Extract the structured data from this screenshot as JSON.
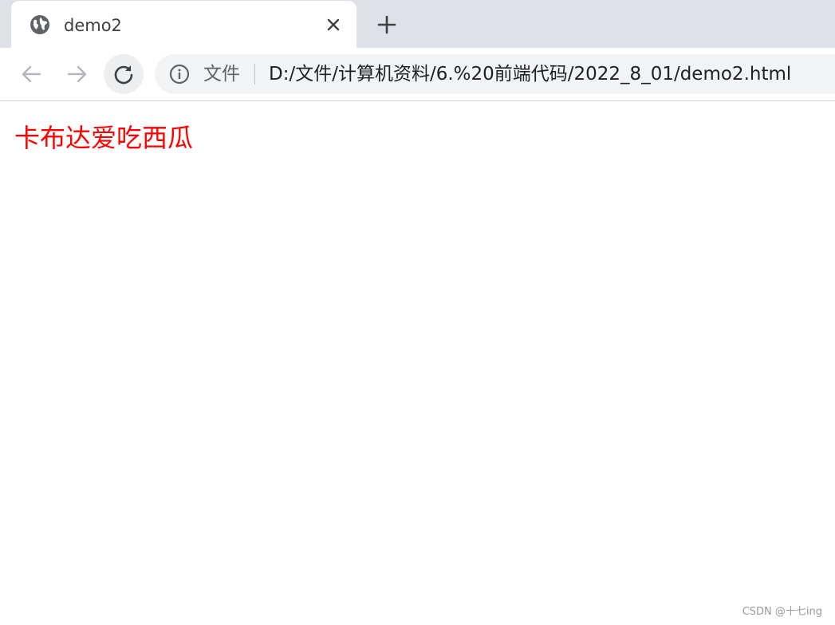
{
  "tab": {
    "title": "demo2",
    "favicon": "globe-icon",
    "close_icon": "close-icon"
  },
  "tabstrip": {
    "new_tab_icon": "plus-icon"
  },
  "toolbar": {
    "back_icon": "arrow-left-icon",
    "forward_icon": "arrow-right-icon",
    "reload_icon": "reload-icon"
  },
  "omnibox": {
    "info_icon": "info-icon",
    "scheme_label": "文件",
    "url": "D:/文件/计算机资料/6.%20前端代码/2022_8_01/demo2.html"
  },
  "page": {
    "text": "卡布达爱吃西瓜",
    "text_color": "#ff0000"
  },
  "watermark": {
    "text": "CSDN @十七ing"
  },
  "colors": {
    "tabstrip_bg": "#dee1e6",
    "omnibox_bg": "#f1f3f4"
  }
}
